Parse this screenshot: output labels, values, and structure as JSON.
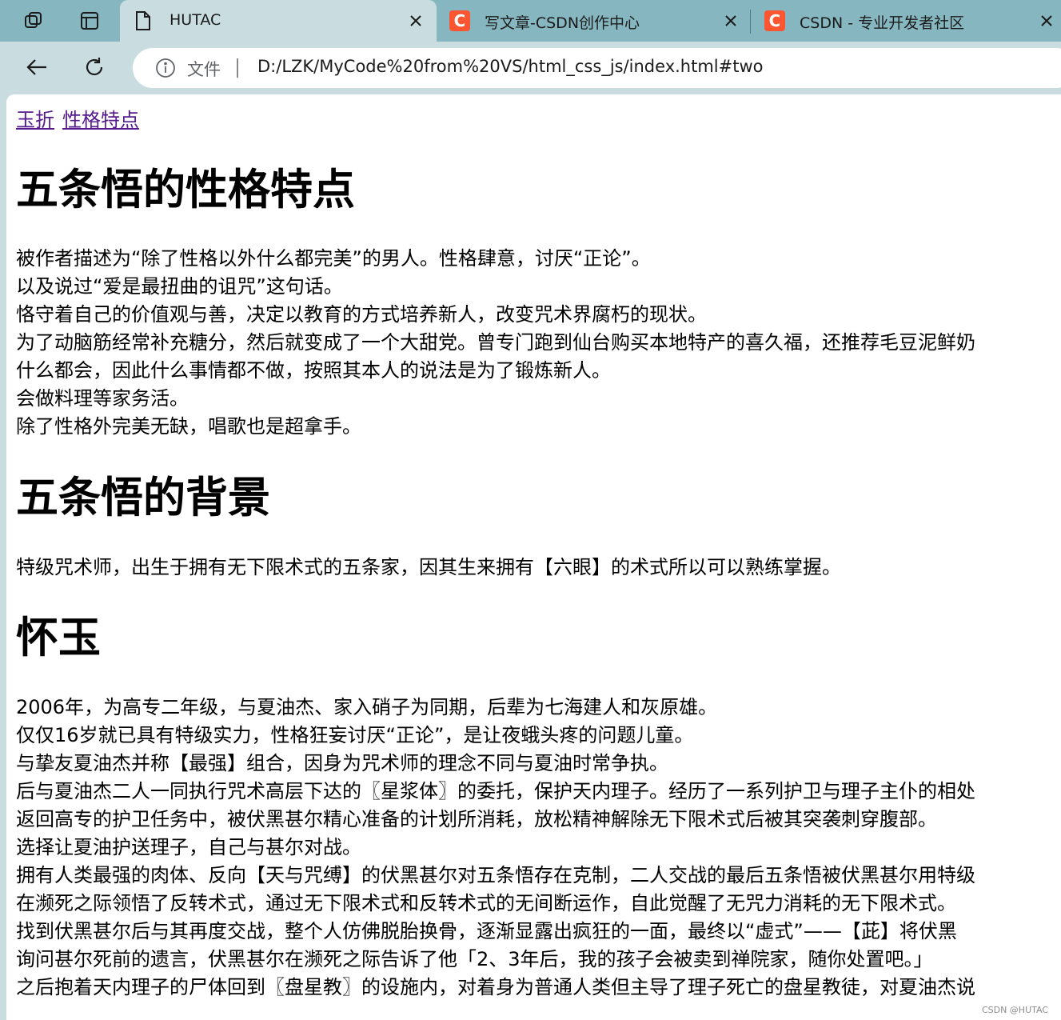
{
  "browser": {
    "tabs": [
      {
        "title": "HUTAC",
        "icon": "page-icon",
        "active": true
      },
      {
        "title": "写文章-CSDN创作中心",
        "icon": "csdn-favicon",
        "active": false
      },
      {
        "title": "CSDN - 专业开发者社区",
        "icon": "csdn-favicon",
        "active": false
      }
    ],
    "favicon_letter": "C",
    "address": {
      "scheme_label": "文件",
      "url": "D:/LZK/MyCode%20from%20VS/html_css_js/index.html#two"
    },
    "colors": {
      "tabstrip": "#86b6bf",
      "chrome": "#c9dde0",
      "csdn": "#fc5531",
      "visited_link": "#551a8b"
    }
  },
  "page": {
    "nav_links": [
      "玉折",
      "性格特点"
    ],
    "sections": [
      {
        "heading": "五条悟的性格特点",
        "lines": [
          "被作者描述为“除了性格以外什么都完美”的男人。性格肆意，讨厌“正论”。",
          "以及说过“爱是最扭曲的诅咒”这句话。",
          "恪守着自己的价值观与善，决定以教育的方式培养新人，改变咒术界腐朽的现状。",
          "为了动脑筋经常补充糖分，然后就变成了一个大甜党。曾专门跑到仙台购买本地特产的喜久福，还推荐毛豆泥鲜奶",
          "什么都会，因此什么事情都不做，按照其本人的说法是为了锻炼新人。",
          "会做料理等家务活。",
          "除了性格外完美无缺，唱歌也是超拿手。"
        ]
      },
      {
        "heading": "五条悟的背景",
        "lines": [
          "特级咒术师，出生于拥有无下限术式的五条家，因其生来拥有【六眼】的术式所以可以熟练掌握。"
        ]
      },
      {
        "heading": "怀玉",
        "lines": [
          "2006年，为高专二年级，与夏油杰、家入硝子为同期，后辈为七海建人和灰原雄。",
          "仅仅16岁就已具有特级实力，性格狂妄讨厌“正论”，是让夜蛾头疼的问题儿童。",
          "与挚友夏油杰并称【最强】组合，因身为咒术师的理念不同与夏油时常争执。",
          "后与夏油杰二人一同执行咒术高层下达的〖星浆体〗的委托，保护天内理子。经历了一系列护卫与理子主仆的相处",
          "返回高专的护卫任务中，被伏黑甚尔精心准备的计划所消耗，放松精神解除无下限术式后被其突袭刺穿腹部。",
          "选择让夏油护送理子，自己与甚尔对战。",
          "拥有人类最强的肉体、反向【天与咒缚】的伏黑甚尔对五条悟存在克制，二人交战的最后五条悟被伏黑甚尔用特级",
          "在濒死之际领悟了反转术式，通过无下限术式和反转术式的无间断运作，自此觉醒了无咒力消耗的无下限术式。",
          "找到伏黑甚尔后与其再度交战，整个人仿佛脱胎换骨，逐渐显露出疯狂的一面，最终以“虚式”——【茈】将伏黑",
          "询问甚尔死前的遗言，伏黑甚尔在濒死之际告诉了他「2、3年后，我的孩子会被卖到禅院家，随你处置吧。」",
          "之后抱着天内理子的尸体回到〖盘星教〗的设施内，对着身为普通人类但主导了理子死亡的盘星教徒，对夏油杰说"
        ]
      }
    ],
    "watermark": "CSDN @HUTAC"
  }
}
